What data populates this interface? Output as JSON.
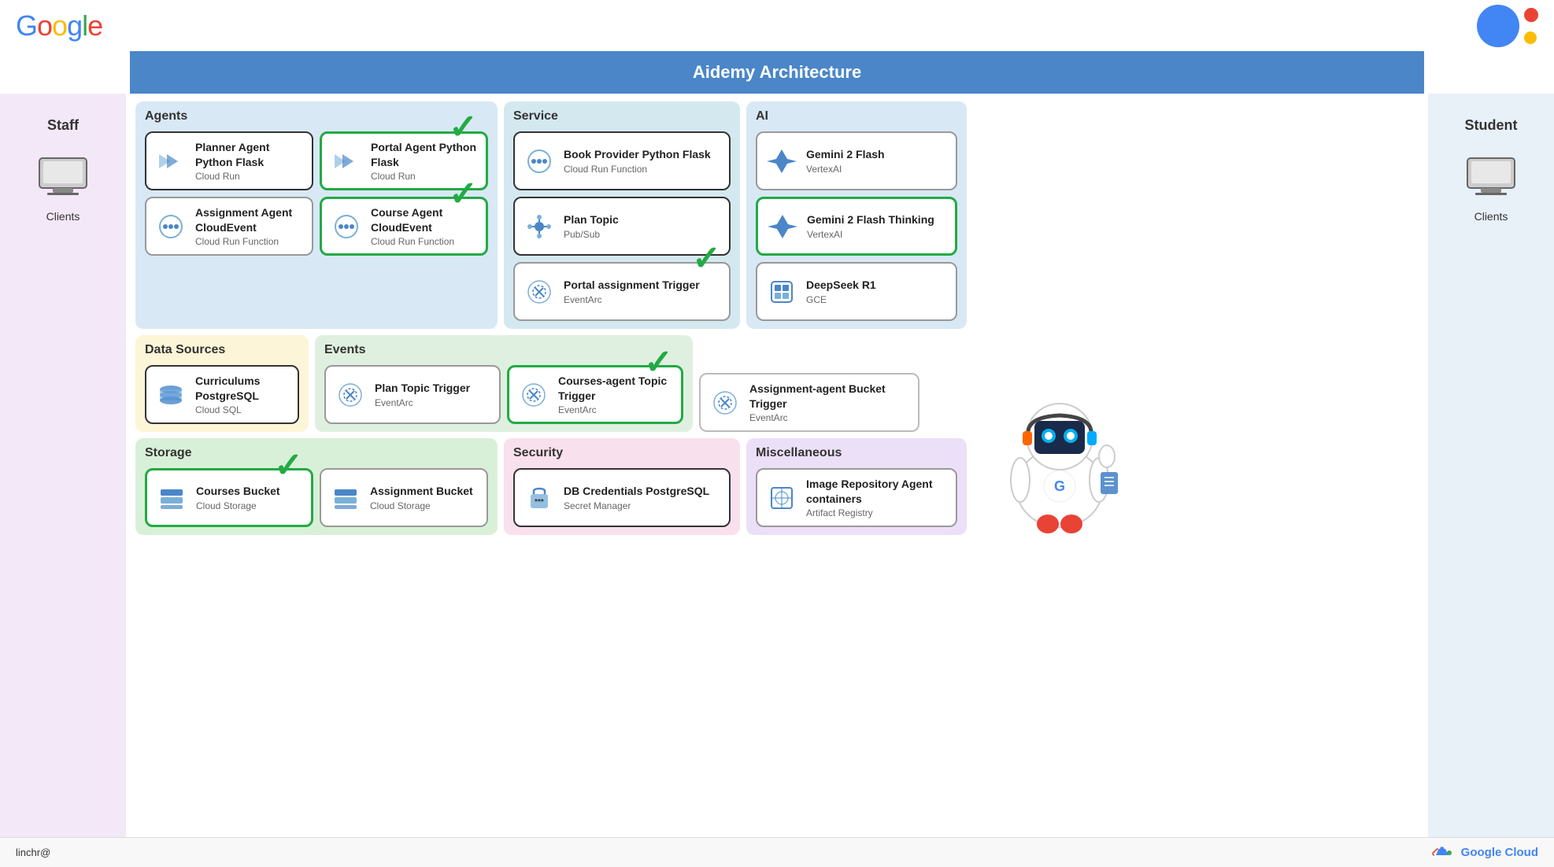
{
  "header": {
    "title": "Aidemy Architecture",
    "google_logo": "Google",
    "footer_user": "linchr@",
    "google_cloud_text": "Google Cloud"
  },
  "sidebar_left": {
    "label": "Staff",
    "client_label": "Clients"
  },
  "sidebar_right": {
    "label": "Student",
    "client_label": "Clients"
  },
  "agents": {
    "section_title": "Agents",
    "cards": [
      {
        "id": "planner-agent",
        "title": "Planner Agent Python Flask",
        "sub": "Cloud Run",
        "border": "dark",
        "icon": "double-arrow"
      },
      {
        "id": "portal-agent",
        "title": "Portal Agent Python Flask",
        "sub": "Cloud Run",
        "border": "green",
        "icon": "double-arrow",
        "checkmark": true
      },
      {
        "id": "assignment-agent",
        "title": "Assignment Agent CloudEvent",
        "sub": "Cloud Run Function",
        "border": "normal",
        "icon": "cloudevent"
      },
      {
        "id": "course-agent",
        "title": "Course Agent CloudEvent",
        "sub": "Cloud Run Function",
        "border": "green",
        "icon": "cloudevent",
        "checkmark": true
      }
    ]
  },
  "service": {
    "section_title": "Service",
    "cards": [
      {
        "id": "book-provider",
        "title": "Book Provider Python Flask",
        "sub": "Cloud Run Function",
        "border": "dark",
        "icon": "cloudevent"
      },
      {
        "id": "plan-topic",
        "title": "Plan Topic",
        "sub": "Pub/Sub",
        "border": "dark",
        "icon": "pubsub"
      },
      {
        "id": "portal-assignment-trigger",
        "title": "Portal assignment Trigger",
        "sub": "EventArc",
        "border": "normal",
        "icon": "eventarc",
        "checkmark": true
      }
    ]
  },
  "ai": {
    "section_title": "AI",
    "cards": [
      {
        "id": "gemini-flash",
        "title": "Gemini 2 Flash",
        "sub": "VertexAI",
        "border": "normal",
        "icon": "gemini"
      },
      {
        "id": "gemini-flash-thinking",
        "title": "Gemini 2 Flash Thinking",
        "sub": "VertexAI",
        "border": "green",
        "icon": "gemini"
      },
      {
        "id": "deepseek-r1",
        "title": "DeepSeek R1",
        "sub": "GCE",
        "border": "normal",
        "icon": "deepseek"
      }
    ]
  },
  "datasources": {
    "section_title": "Data Sources",
    "cards": [
      {
        "id": "curriculums-postgresql",
        "title": "Curriculums PostgreSQL",
        "sub": "Cloud SQL",
        "border": "dark",
        "icon": "cloudsql"
      }
    ]
  },
  "events": {
    "section_title": "Events",
    "cards": [
      {
        "id": "plan-topic-trigger",
        "title": "Plan Topic Trigger",
        "sub": "EventArc",
        "border": "normal",
        "icon": "eventarc"
      },
      {
        "id": "courses-agent-topic-trigger",
        "title": "Courses-agent Topic Trigger",
        "sub": "EventArc",
        "border": "green",
        "icon": "eventarc",
        "checkmark": true
      },
      {
        "id": "assignment-agent-bucket-trigger",
        "title": "Assignment-agent Bucket Trigger",
        "sub": "EventArc",
        "border": "normal",
        "icon": "eventarc"
      }
    ]
  },
  "storage": {
    "section_title": "Storage",
    "cards": [
      {
        "id": "courses-bucket",
        "title": "Courses Bucket",
        "sub": "Cloud Storage",
        "border": "green",
        "icon": "storage",
        "checkmark": true
      },
      {
        "id": "assignment-bucket",
        "title": "Assignment Bucket",
        "sub": "Cloud Storage",
        "border": "normal",
        "icon": "storage"
      }
    ]
  },
  "security": {
    "section_title": "Security",
    "cards": [
      {
        "id": "db-credentials",
        "title": "DB Credentials PostgreSQL",
        "sub": "Secret Manager",
        "border": "dark",
        "icon": "secret"
      }
    ]
  },
  "misc": {
    "section_title": "Miscellaneous",
    "cards": [
      {
        "id": "image-repository",
        "title": "Image Repository Agent containers",
        "sub": "Artifact Registry",
        "border": "normal",
        "icon": "registry"
      }
    ]
  }
}
